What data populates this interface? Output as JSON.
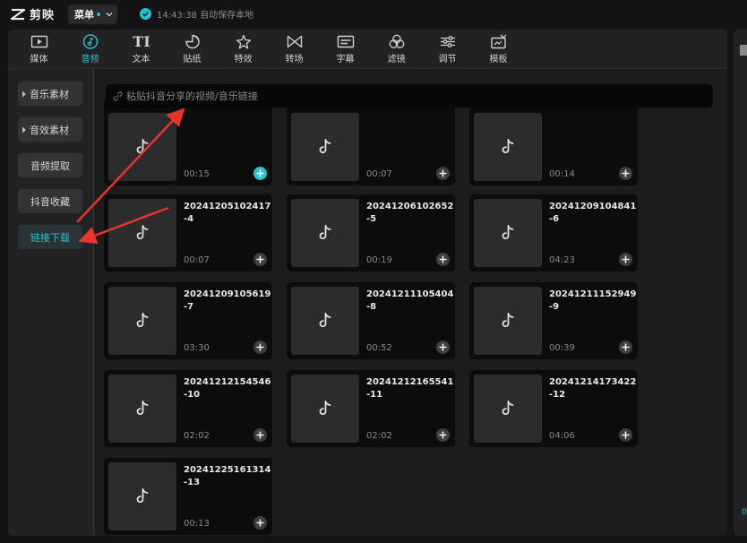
{
  "app": {
    "name": "剪映",
    "menu_label": "菜单",
    "save_status": "14:43:38 自动保存本地"
  },
  "tabs": [
    {
      "label": "媒体",
      "icon": "media-icon"
    },
    {
      "label": "音频",
      "icon": "audio-icon"
    },
    {
      "label": "文本",
      "icon": "text-icon"
    },
    {
      "label": "贴纸",
      "icon": "sticker-icon"
    },
    {
      "label": "特效",
      "icon": "effects-icon"
    },
    {
      "label": "转场",
      "icon": "transition-icon"
    },
    {
      "label": "字幕",
      "icon": "subtitle-icon"
    },
    {
      "label": "滤镜",
      "icon": "filter-icon"
    },
    {
      "label": "调节",
      "icon": "adjust-icon"
    },
    {
      "label": "模板",
      "icon": "template-icon"
    }
  ],
  "active_tab": "音频",
  "sidebar": {
    "items": [
      {
        "label": "音乐素材",
        "has_caret": true
      },
      {
        "label": "音效素材",
        "has_caret": true
      },
      {
        "label": "音频提取",
        "has_caret": false
      },
      {
        "label": "抖音收藏",
        "has_caret": false
      },
      {
        "label": "链接下载",
        "has_caret": false
      }
    ],
    "active": "链接下载"
  },
  "link_input": {
    "placeholder": "粘贴抖音分享的视频/音乐链接"
  },
  "tracks": [
    {
      "title": "",
      "duration": "00:15",
      "add_active": true
    },
    {
      "title": "",
      "duration": "00:07",
      "add_active": false
    },
    {
      "title": "",
      "duration": "00:14",
      "add_active": false
    },
    {
      "title": "20241205102417-4",
      "duration": "00:07",
      "add_active": false
    },
    {
      "title": "20241206102652-5",
      "duration": "00:19",
      "add_active": false
    },
    {
      "title": "20241209104841-6",
      "duration": "04:23",
      "add_active": false
    },
    {
      "title": "20241209105619-7",
      "duration": "03:30",
      "add_active": false
    },
    {
      "title": "20241211105404-8",
      "duration": "00:52",
      "add_active": false
    },
    {
      "title": "20241211152949-9",
      "duration": "00:39",
      "add_active": false
    },
    {
      "title": "20241212154546-10",
      "duration": "02:02",
      "add_active": false
    },
    {
      "title": "20241212165541-11",
      "duration": "02:02",
      "add_active": false
    },
    {
      "title": "20241214173422-12",
      "duration": "04:06",
      "add_active": false
    },
    {
      "title": "20241225161314-13",
      "duration": "00:13",
      "add_active": false
    }
  ],
  "right_panel_text": "0",
  "colors": {
    "accent": "#23c4cf",
    "annotation_arrow": "#e8342a"
  }
}
